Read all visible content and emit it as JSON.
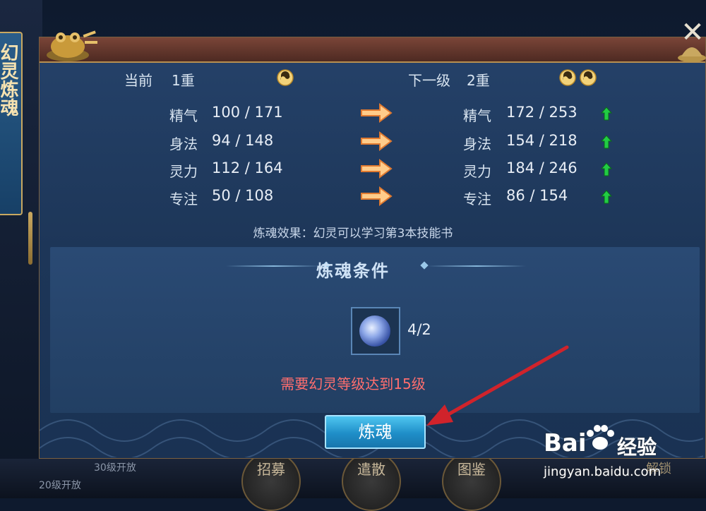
{
  "side_tab": {
    "label": "幻灵炼魂"
  },
  "current": {
    "label": "当前",
    "level": "1重"
  },
  "next": {
    "label": "下一级",
    "level": "2重"
  },
  "stats": [
    {
      "name": "精气",
      "current": "100 / 171",
      "next": "172 / 253"
    },
    {
      "name": "身法",
      "current": "94 / 148",
      "next": "154 / 218"
    },
    {
      "name": "灵力",
      "current": "112 / 164",
      "next": "184 / 246"
    },
    {
      "name": "专注",
      "current": "50 / 108",
      "next": "86 / 154"
    }
  ],
  "effect_text": "炼魂效果：幻灵可以学习第3本技能书",
  "conditions": {
    "title": "炼魂条件",
    "item_count": "4/2",
    "requirement": "需要幻灵等级达到15级"
  },
  "action_button": "炼魂",
  "close_symbol": "✕",
  "bottom": {
    "buttons": [
      "招募",
      "遣散",
      "图鉴"
    ],
    "level_text_1": "30级开放",
    "level_text_2": "20级开放",
    "right_text": "解锁"
  },
  "watermark": {
    "brand": "Bai",
    "brand2": "经验",
    "url": "jingyan.baidu.com"
  },
  "colors": {
    "requirement": "#ff6e6e",
    "button": "#1f8ec8",
    "up_arrow": "#22cc44",
    "annotation_arrow": "#d0232b"
  },
  "icons": [
    "toad-icon",
    "yin-yang-icon",
    "right-arrow-icon",
    "up-arrow-icon",
    "soul-orb-icon",
    "close-icon"
  ]
}
